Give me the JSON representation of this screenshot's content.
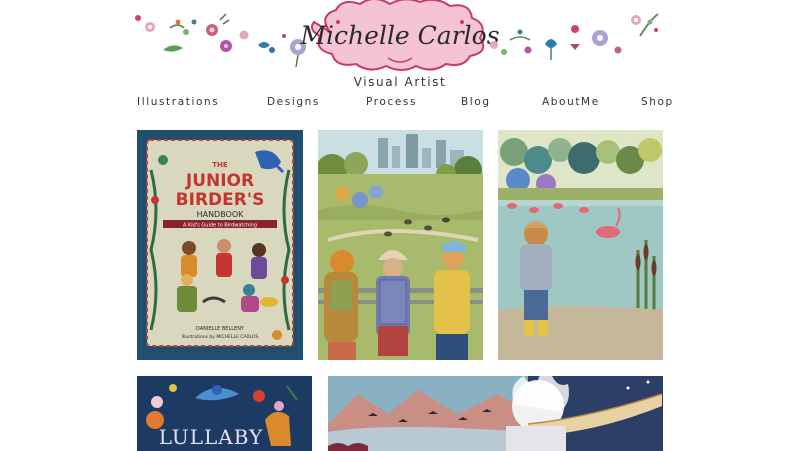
{
  "site": {
    "logo_text": "Michelle Carlos",
    "tagline": "Visual Artist"
  },
  "nav": {
    "items": [
      {
        "label": "Illustrations"
      },
      {
        "label": "Designs"
      },
      {
        "label": "Process"
      },
      {
        "label": "Blog"
      },
      {
        "label": "AboutMe"
      },
      {
        "label": "Shop"
      }
    ]
  },
  "gallery": {
    "book_cover": {
      "title_line1": "THE",
      "title_line2": "JUNIOR",
      "title_line3": "BIRDER'S",
      "subtitle": "HANDBOOK",
      "tagline": "A Kid's Guide to Birdwatching",
      "author": "DANIELLE BELLENY",
      "illustrator": "Illustrations by MICHELLE CARLOS"
    },
    "lullaby_title": "LULLABY"
  },
  "colors": {
    "logo_cloud": "#f4c4d2",
    "logo_outline": "#c73a6b",
    "book_bg": "#1f4e6e",
    "book_inner": "#d9d7bd",
    "book_title_red": "#c3362f",
    "lullaby_bg": "#1d3a63",
    "night_bg": "#2c3f66"
  }
}
